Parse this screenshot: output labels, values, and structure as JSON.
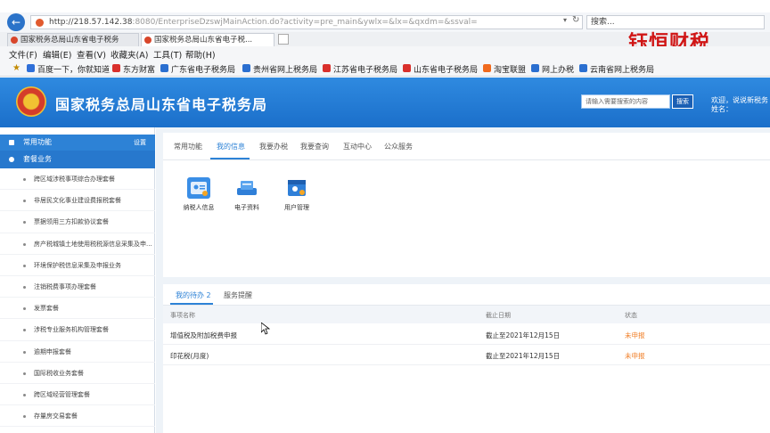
{
  "browser": {
    "url_main": "http://218.57.142.38",
    "url_rest": ":8080/EnterpriseDzswjMainAction.do?activity=pre_main&ywlx=&lx=&qxdm=&ssval=",
    "search_placeholder": "搜索...",
    "tabs": [
      {
        "label": "国家税务总局山东省电子税务"
      },
      {
        "label": "国家税务总局山东省电子税..."
      }
    ],
    "menu": [
      "文件(F)",
      "编辑(E)",
      "查看(V)",
      "收藏夹(A)",
      "工具(T)",
      "帮助(H)"
    ],
    "bookmarks": [
      {
        "label": "百度一下，你就知道",
        "color": "#2f6fd8"
      },
      {
        "label": "东方财富",
        "color": "#d9302c"
      },
      {
        "label": "广东省电子税务局",
        "color": "#2b6fd0"
      },
      {
        "label": "贵州省网上税务局",
        "color": "#2b6fd0"
      },
      {
        "label": "江苏省电子税务局",
        "color": "#d9302c"
      },
      {
        "label": "山东省电子税务局",
        "color": "#d9302c"
      },
      {
        "label": "淘宝联盟",
        "color": "#f06a1e"
      },
      {
        "label": "网上办税",
        "color": "#2b6fd0"
      },
      {
        "label": "云南省网上税务局",
        "color": "#2b6fd0"
      }
    ]
  },
  "watermark": "钰恒财税",
  "header": {
    "title": "国家税务总局山东省电子税务局",
    "search_placeholder": "请输入需要搜索的内容",
    "search_button": "搜索",
    "welcome": "欢迎，说说新税务",
    "welcome_sub": "姓名："
  },
  "sidebar": {
    "common_label": "常用功能",
    "settings_label": "设置",
    "business_label": "套餐业务",
    "items": [
      "跨区域涉税事项综合办理套餐",
      "非居民文化事业建设费报税套餐",
      "票据领用三方扣款协议套餐",
      "房产税城镇土地使用税税源信息采集及申...",
      "环境保护税信息采集及申报业务",
      "注销税费事项办理套餐",
      "发票套餐",
      "涉税专业服务机构管理套餐",
      "逾期申报套餐",
      "国际税收业务套餐",
      "跨区域经营管理套餐",
      "存量房交易套餐"
    ]
  },
  "services": {
    "tabs": [
      "常用功能",
      "我的信息",
      "我要办税",
      "我要查询",
      "互动中心",
      "公众服务"
    ],
    "tiles": [
      {
        "label": "纳税人信息",
        "color": "#3a8ee6"
      },
      {
        "label": "电子资料",
        "color": "#2f7fd8"
      },
      {
        "label": "用户管理",
        "color": "#2f7fd8"
      }
    ]
  },
  "todo": {
    "tabs": [
      "我的待办 2",
      "服务提醒"
    ],
    "columns": [
      "事项名称",
      "截止日期",
      "状态"
    ],
    "rows": [
      {
        "name": "增值税及附加税费申报",
        "deadline": "截止至2021年12月15日",
        "status": "未申报"
      },
      {
        "name": "印花税(月度)",
        "deadline": "截止至2021年12月15日",
        "status": "未申报"
      }
    ]
  }
}
